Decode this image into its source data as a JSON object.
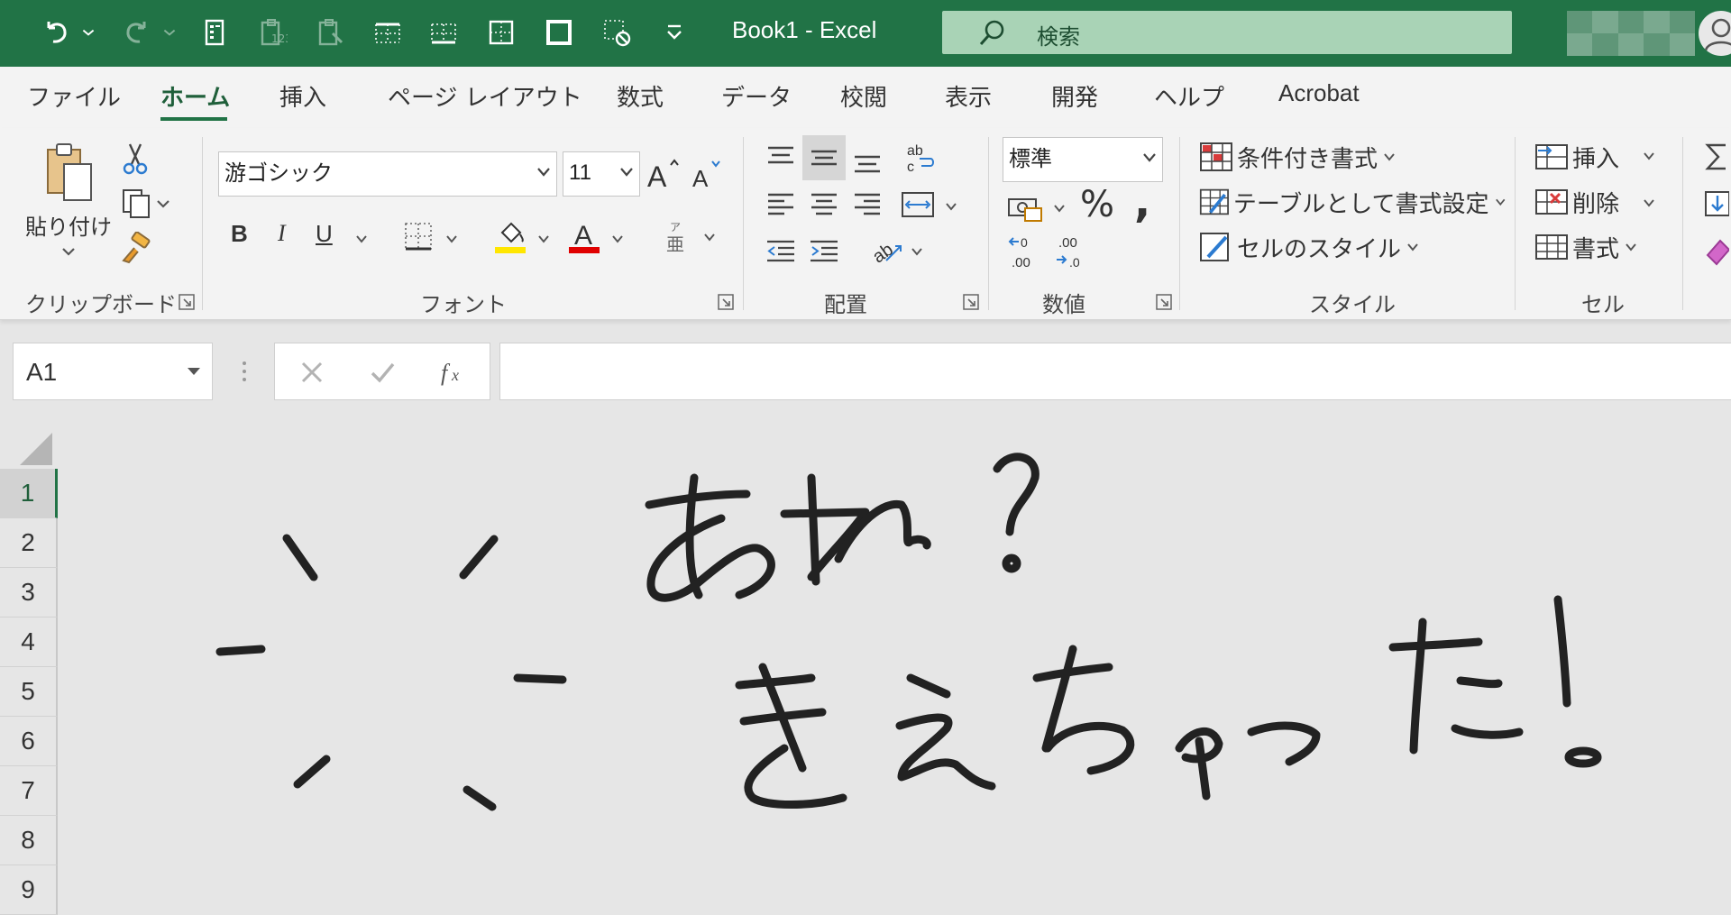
{
  "title_bar": {
    "document_title": "Book1  -  Excel",
    "search_placeholder": "検索"
  },
  "tabs": [
    {
      "label": "ファイル"
    },
    {
      "label": "ホーム",
      "active": true
    },
    {
      "label": "挿入"
    },
    {
      "label": "ページ レイアウト"
    },
    {
      "label": "数式"
    },
    {
      "label": "データ"
    },
    {
      "label": "校閲"
    },
    {
      "label": "表示"
    },
    {
      "label": "開発"
    },
    {
      "label": "ヘルプ"
    },
    {
      "label": "Acrobat"
    }
  ],
  "ribbon": {
    "clipboard": {
      "paste_label": "貼り付け",
      "group_label": "クリップボード"
    },
    "font": {
      "font_name": "游ゴシック",
      "font_size": "11",
      "bold": "B",
      "italic": "I",
      "underline": "U",
      "group_label": "フォント"
    },
    "alignment": {
      "group_label": "配置"
    },
    "number": {
      "format": "標準",
      "percent": "%",
      "comma": ",",
      "group_label": "数値"
    },
    "styles": {
      "conditional": "条件付き書式",
      "as_table": "テーブルとして書式設定",
      "cell_styles": "セルのスタイル",
      "group_label": "スタイル"
    },
    "cells": {
      "insert": "挿入",
      "delete": "削除",
      "format": "書式",
      "group_label": "セル"
    }
  },
  "formula_bar": {
    "name_box": "A1",
    "formula": ""
  },
  "rows": [
    "1",
    "2",
    "3",
    "4",
    "5",
    "6",
    "7",
    "8",
    "9"
  ],
  "active_row": "1",
  "colors": {
    "excel_green": "#217346",
    "highlight_yellow": "#ffe600",
    "font_red": "#e00000"
  }
}
